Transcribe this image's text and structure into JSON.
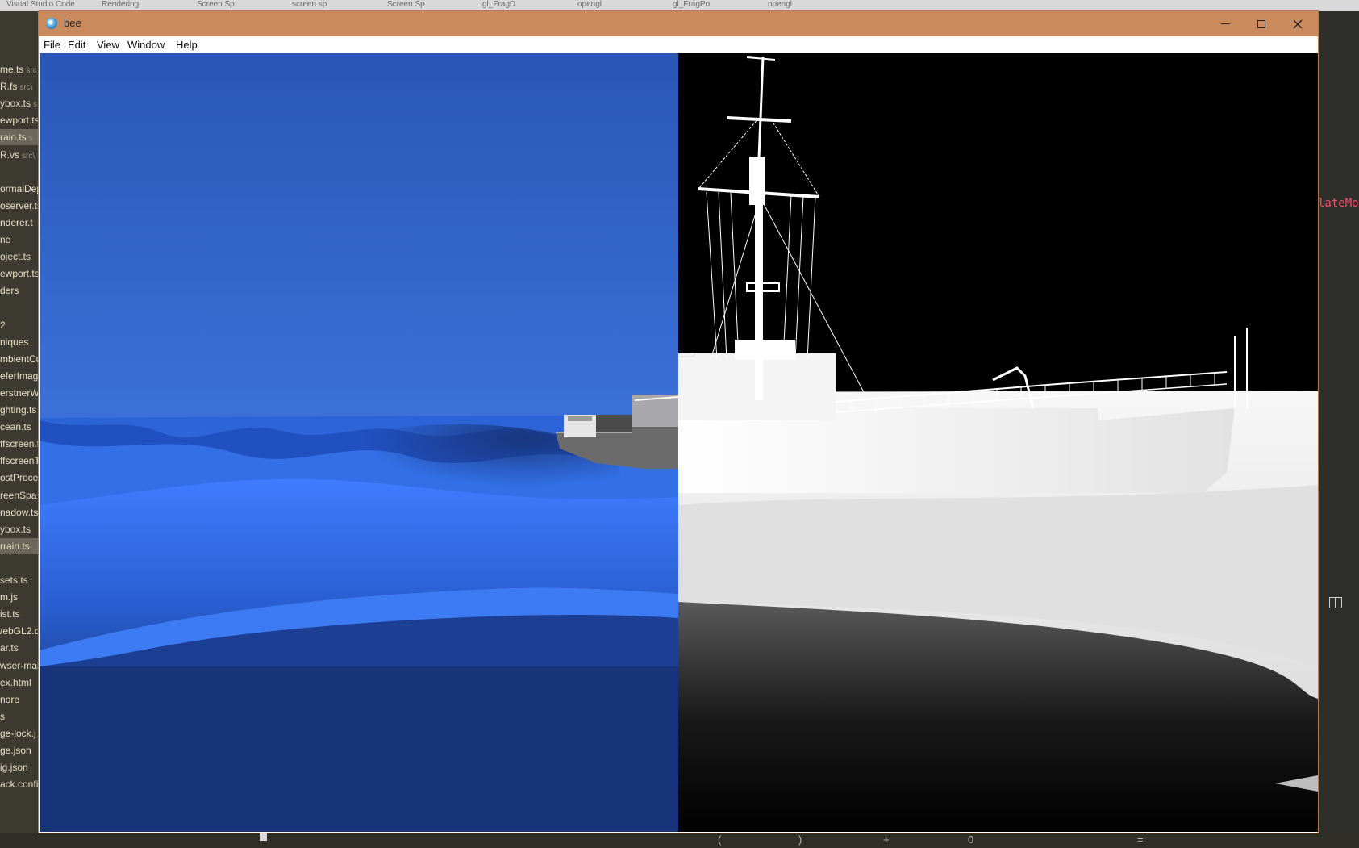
{
  "background_tabs": [
    "Visual Studio Code",
    "Rendering",
    "Screen Sp",
    "screen sp",
    "Screen Sp",
    "gl_FragD",
    "opengl",
    "gl_FragPo",
    "opengl"
  ],
  "explorer": {
    "items": [
      {
        "label": "me.ts",
        "path": "src",
        "selected": false
      },
      {
        "label": "R.fs",
        "path": "src\\",
        "selected": false
      },
      {
        "label": "ybox.ts",
        "path": "s",
        "selected": false
      },
      {
        "label": "ewport.ts",
        "path": "",
        "selected": false
      },
      {
        "label": "rain.ts",
        "path": "s",
        "selected": true
      },
      {
        "label": "R.vs",
        "path": "src\\",
        "selected": false
      },
      {
        "label": "",
        "path": "",
        "selected": false
      },
      {
        "label": "ormalDep",
        "path": "",
        "selected": false
      },
      {
        "label": "oserver.ts",
        "path": "",
        "selected": false
      },
      {
        "label": "nderer.t",
        "path": "",
        "selected": false
      },
      {
        "label": "ne",
        "path": "",
        "selected": false
      },
      {
        "label": "oject.ts",
        "path": "",
        "selected": false
      },
      {
        "label": "ewport.ts",
        "path": "",
        "selected": false
      },
      {
        "label": "ders",
        "path": "",
        "selected": false
      },
      {
        "label": "",
        "path": "",
        "selected": false
      },
      {
        "label": "2",
        "path": "",
        "selected": false
      },
      {
        "label": "niques",
        "path": "",
        "selected": false
      },
      {
        "label": "mbientCu",
        "path": "",
        "selected": false
      },
      {
        "label": "eferImag",
        "path": "",
        "selected": false
      },
      {
        "label": "erstnerW",
        "path": "",
        "selected": false
      },
      {
        "label": "ghting.ts",
        "path": "",
        "selected": false
      },
      {
        "label": "cean.ts",
        "path": "",
        "selected": false
      },
      {
        "label": "ffscreen.t",
        "path": "",
        "selected": false
      },
      {
        "label": "ffscreenT",
        "path": "",
        "selected": false
      },
      {
        "label": "ostProce",
        "path": "",
        "selected": false
      },
      {
        "label": "reenSpa",
        "path": "",
        "selected": false
      },
      {
        "label": "nadow.ts",
        "path": "",
        "selected": false
      },
      {
        "label": "ybox.ts",
        "path": "",
        "selected": false
      },
      {
        "label": "rrain.ts",
        "path": "",
        "selected": true
      },
      {
        "label": "",
        "path": "",
        "selected": false
      },
      {
        "label": "sets.ts",
        "path": "",
        "selected": false
      },
      {
        "label": "m.js",
        "path": "",
        "selected": false
      },
      {
        "label": "ist.ts",
        "path": "",
        "selected": false
      },
      {
        "label": "/ebGL2.d",
        "path": "",
        "selected": false
      },
      {
        "label": "ar.ts",
        "path": "",
        "selected": false
      },
      {
        "label": "wser-mai",
        "path": "",
        "selected": false
      },
      {
        "label": "ex.html",
        "path": "",
        "selected": false
      },
      {
        "label": "nore",
        "path": "",
        "selected": false
      },
      {
        "label": "s",
        "path": "",
        "selected": false
      },
      {
        "label": "ge-lock.j",
        "path": "",
        "selected": false
      },
      {
        "label": "ge.json",
        "path": "",
        "selected": false
      },
      {
        "label": "ig.json",
        "path": "",
        "selected": false
      },
      {
        "label": "ack.confi",
        "path": "",
        "selected": false
      }
    ]
  },
  "right_code": "lateMo",
  "bottom_bar": {
    "left": "(",
    "mid": ")",
    "plus": "+",
    "value": "0",
    "eq": "="
  },
  "window": {
    "title": "bee",
    "menu": [
      "File",
      "Edit",
      "View",
      "Window",
      "Help"
    ],
    "controls": {
      "minimize": "minimize-icon",
      "maximize": "maximize-icon",
      "close": "close-icon"
    }
  },
  "scene": {
    "left_view": "color-render",
    "right_view": "depth-render",
    "colors": {
      "sky_top": "#2a55b3",
      "sky_horizon": "#4d8cff",
      "ocean_light": "#3a72e8",
      "ocean_dark": "#0e1f45",
      "hull_gray": "#6a6a6a",
      "depth_black": "#000000",
      "depth_white": "#ffffff",
      "titlebar": "#c98a5e"
    }
  }
}
